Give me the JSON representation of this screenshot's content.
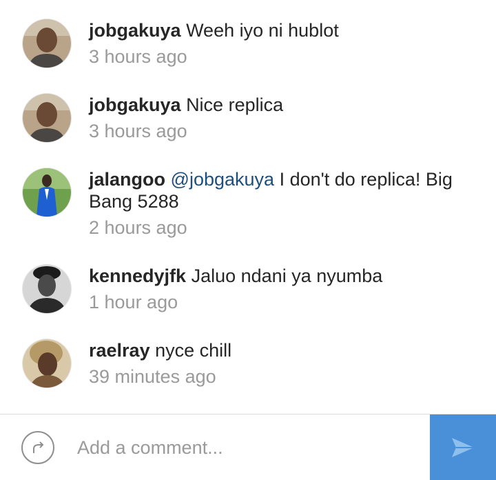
{
  "comments": [
    {
      "username": "jobgakuya",
      "text": "Weeh iyo ni hublot",
      "timestamp": "3 hours ago"
    },
    {
      "username": "jobgakuya",
      "text": "Nice replica",
      "timestamp": "3 hours ago"
    },
    {
      "username": "jalangoo",
      "mention": "@jobgakuya",
      "text": "I don't do replica! Big Bang 5288",
      "timestamp": "2 hours ago"
    },
    {
      "username": "kennedyjfk",
      "text": "Jaluo ndani ya nyumba",
      "timestamp": "1 hour ago"
    },
    {
      "username": "raelray",
      "text": "nyce chill",
      "timestamp": "39 minutes ago"
    }
  ],
  "composer": {
    "placeholder": "Add a comment...",
    "value": ""
  },
  "colors": {
    "send_button": "#4a90d9",
    "mention": "#1d4f7e",
    "timestamp": "#9a9a9a"
  },
  "icons": {
    "share": "share-arrow-icon",
    "send": "send-paper-plane-icon"
  }
}
